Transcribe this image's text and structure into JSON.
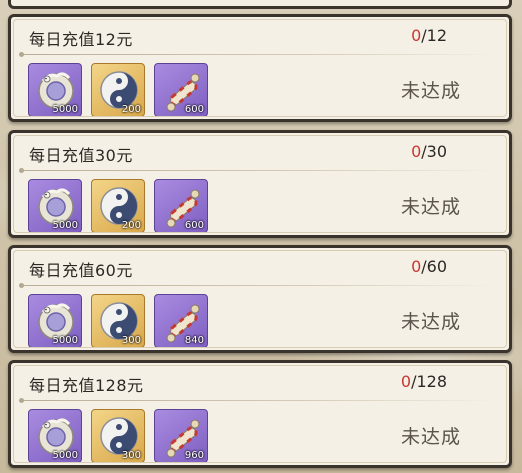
{
  "cards": [
    {
      "title": "每日充值12元",
      "current": "0",
      "target": "/12",
      "status": "未达成",
      "rewards": [
        {
          "icon": "jade-dragon-icon",
          "qty": "5000"
        },
        {
          "icon": "yin-yang-coin-icon",
          "qty": "200"
        },
        {
          "icon": "scroll-icon",
          "qty": "600"
        }
      ]
    },
    {
      "title": "每日充值30元",
      "current": "0",
      "target": "/30",
      "status": "未达成",
      "rewards": [
        {
          "icon": "jade-dragon-icon",
          "qty": "5000"
        },
        {
          "icon": "yin-yang-coin-icon",
          "qty": "200"
        },
        {
          "icon": "scroll-icon",
          "qty": "600"
        }
      ]
    },
    {
      "title": "每日充值60元",
      "current": "0",
      "target": "/60",
      "status": "未达成",
      "rewards": [
        {
          "icon": "jade-dragon-icon",
          "qty": "5000"
        },
        {
          "icon": "yin-yang-coin-icon",
          "qty": "300"
        },
        {
          "icon": "scroll-icon",
          "qty": "840"
        }
      ]
    },
    {
      "title": "每日充值128元",
      "current": "0",
      "target": "/128",
      "status": "未达成",
      "rewards": [
        {
          "icon": "jade-dragon-icon",
          "qty": "5000"
        },
        {
          "icon": "yin-yang-coin-icon",
          "qty": "300"
        },
        {
          "icon": "scroll-icon",
          "qty": "960"
        }
      ]
    }
  ]
}
